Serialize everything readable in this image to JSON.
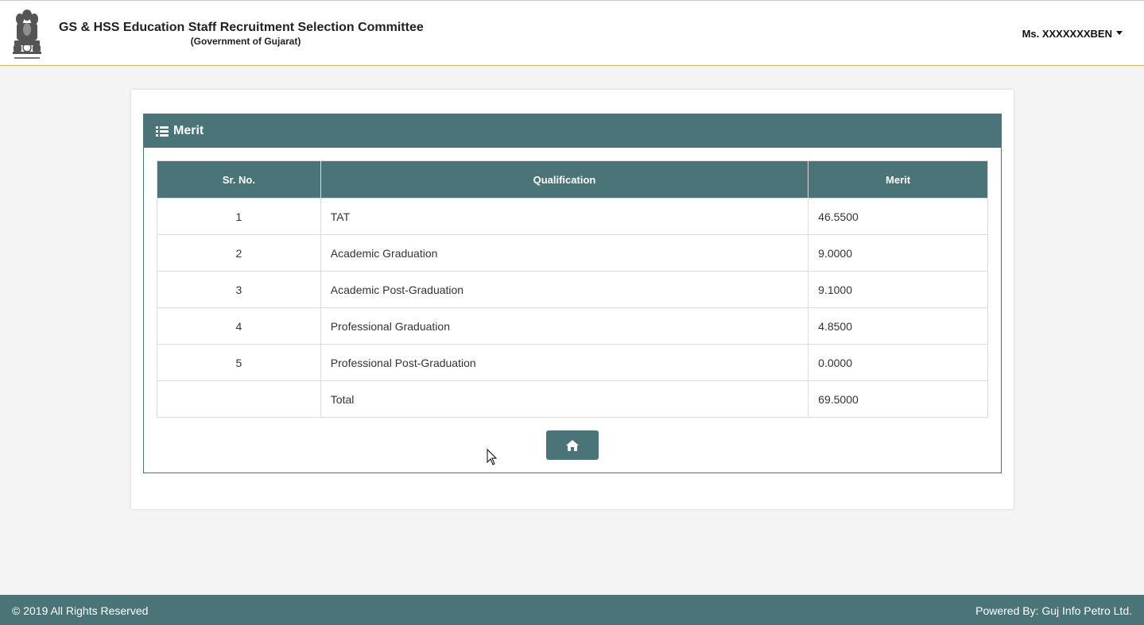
{
  "header": {
    "title": "GS & HSS Education Staff Recruitment Selection Committee",
    "subtitle": "(Government of Gujarat)",
    "user_name": "Ms. XXXXXXXBEN",
    "emblem_icon": "state-emblem-icon"
  },
  "panel": {
    "heading": "Merit",
    "heading_icon": "list-icon"
  },
  "table": {
    "columns": [
      "Sr. No.",
      "Qualification",
      "Merit"
    ],
    "rows": [
      {
        "sr": "1",
        "qualification": "TAT",
        "merit": "46.5500"
      },
      {
        "sr": "2",
        "qualification": "Academic Graduation",
        "merit": "9.0000"
      },
      {
        "sr": "3",
        "qualification": "Academic Post-Graduation",
        "merit": "9.1000"
      },
      {
        "sr": "4",
        "qualification": "Professional Graduation",
        "merit": "4.8500"
      },
      {
        "sr": "5",
        "qualification": "Professional Post-Graduation",
        "merit": "0.0000"
      },
      {
        "sr": "",
        "qualification": "Total",
        "merit": "69.5000"
      }
    ]
  },
  "home_button": {
    "icon": "home-icon"
  },
  "footer": {
    "copyright": "© 2019 All Rights Reserved",
    "powered_by": "Powered By: Guj Info Petro Ltd."
  },
  "colors": {
    "primary": "#4a7478",
    "header_border": "#d9b56a",
    "background": "#f4f4f4"
  }
}
